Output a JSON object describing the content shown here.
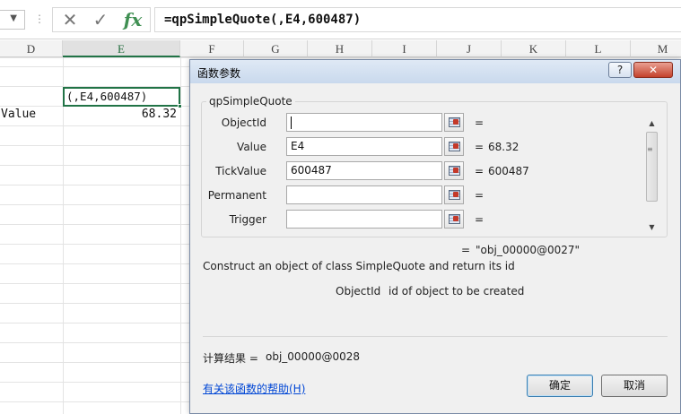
{
  "formula_bar": {
    "cancel_icon": "x-icon",
    "enter_icon": "checkmark-icon",
    "fx_label": "fx",
    "formula": "=qpSimpleQuote(,E4,600487)"
  },
  "columns": [
    "D",
    "E",
    "F",
    "G",
    "H",
    "I",
    "J",
    "K",
    "L",
    "M"
  ],
  "selected_column": "E",
  "cells": {
    "e3_edit": "(,E4,600487)",
    "d4": "Value",
    "e4": "68.32"
  },
  "dialog": {
    "title": "函数参数",
    "help_button": "?",
    "close_button": "✕",
    "function_name": "qpSimpleQuote",
    "args": [
      {
        "label": "ObjectId",
        "value": "",
        "result": ""
      },
      {
        "label": "Value",
        "value": "E4",
        "result": "68.32"
      },
      {
        "label": "TickValue",
        "value": "600487",
        "result": "600487"
      },
      {
        "label": "Permanent",
        "value": "",
        "result": ""
      },
      {
        "label": "Trigger",
        "value": "",
        "result": ""
      }
    ],
    "eq_sign": "=",
    "formula_result": "\"obj_00000@0027\"",
    "description": "Construct an object of class SimpleQuote and return its id",
    "arg_desc_name": "ObjectId",
    "arg_desc_text": "id of object to be created",
    "calc_result_label": "计算结果 =",
    "calc_result_value": "obj_00000@0028",
    "help_link": "有关该函数的帮助(H)",
    "ok_label": "确定",
    "cancel_label": "取消"
  }
}
